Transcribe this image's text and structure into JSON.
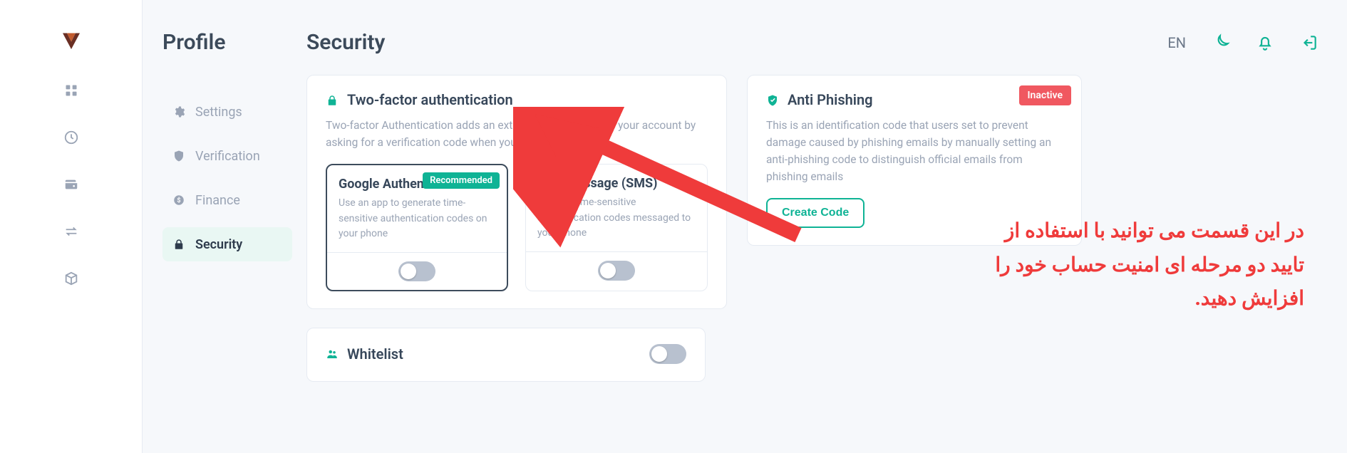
{
  "header": {
    "page_title": "Security",
    "lang_label": "EN"
  },
  "sidebar": {
    "title": "Profile",
    "items": [
      {
        "label": "Settings"
      },
      {
        "label": "Verification"
      },
      {
        "label": "Finance"
      },
      {
        "label": "Security"
      }
    ]
  },
  "twofa": {
    "title": "Two-factor authentication",
    "desc": "Two-factor Authentication adds an extra layer of security to your account by asking for a verification code when you sign in",
    "methods": {
      "google": {
        "title": "Google Authenticator",
        "badge": "Recommended",
        "desc": "Use an app to generate time-sensitive authentication codes on your phone"
      },
      "sms": {
        "title": "Text Message (SMS)",
        "desc": "Receive time-sensitive authentication codes messaged to your phone"
      }
    }
  },
  "anti": {
    "title": "Anti Phishing",
    "status": "Inactive",
    "desc": "This is an identification code that users set to prevent damage caused by phishing emails by manually setting an anti-phishing code to distinguish official emails from phishing emails",
    "cta": "Create Code"
  },
  "whitelist": {
    "title": "Whitelist"
  },
  "annotation": {
    "text": "در این قسمت می توانید با استفاده از تایید دو مرحله ای امنیت حساب خود را افزایش دهید."
  },
  "colors": {
    "teal": "#0fb395",
    "red": "#ef3b3b"
  }
}
